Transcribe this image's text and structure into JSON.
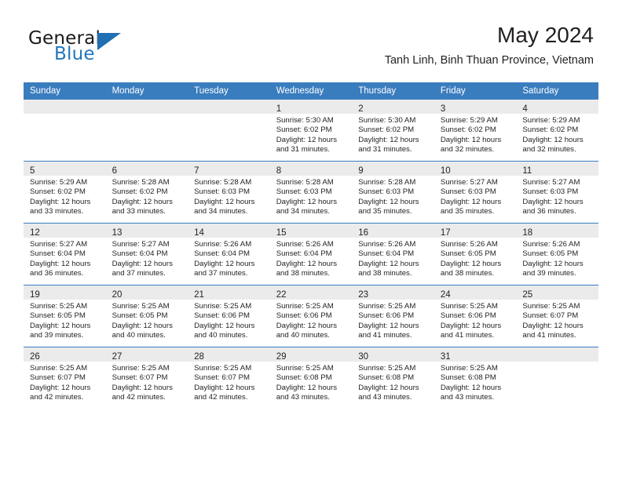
{
  "brand": {
    "name_top": "General",
    "name_bottom": "Blue",
    "accent_color": "#2175ba",
    "triangle_color": "#1f6fb2"
  },
  "header": {
    "title": "May 2024",
    "subtitle": "Tanh Linh, Binh Thuan Province, Vietnam"
  },
  "calendar": {
    "header_bg": "#3a7dbe",
    "daynum_bg": "#ebebeb",
    "weekdays": [
      "Sunday",
      "Monday",
      "Tuesday",
      "Wednesday",
      "Thursday",
      "Friday",
      "Saturday"
    ],
    "weeks": [
      [
        {
          "day": "",
          "lines": []
        },
        {
          "day": "",
          "lines": []
        },
        {
          "day": "",
          "lines": []
        },
        {
          "day": "1",
          "lines": [
            "Sunrise: 5:30 AM",
            "Sunset: 6:02 PM",
            "Daylight: 12 hours",
            "and 31 minutes."
          ]
        },
        {
          "day": "2",
          "lines": [
            "Sunrise: 5:30 AM",
            "Sunset: 6:02 PM",
            "Daylight: 12 hours",
            "and 31 minutes."
          ]
        },
        {
          "day": "3",
          "lines": [
            "Sunrise: 5:29 AM",
            "Sunset: 6:02 PM",
            "Daylight: 12 hours",
            "and 32 minutes."
          ]
        },
        {
          "day": "4",
          "lines": [
            "Sunrise: 5:29 AM",
            "Sunset: 6:02 PM",
            "Daylight: 12 hours",
            "and 32 minutes."
          ]
        }
      ],
      [
        {
          "day": "5",
          "lines": [
            "Sunrise: 5:29 AM",
            "Sunset: 6:02 PM",
            "Daylight: 12 hours",
            "and 33 minutes."
          ]
        },
        {
          "day": "6",
          "lines": [
            "Sunrise: 5:28 AM",
            "Sunset: 6:02 PM",
            "Daylight: 12 hours",
            "and 33 minutes."
          ]
        },
        {
          "day": "7",
          "lines": [
            "Sunrise: 5:28 AM",
            "Sunset: 6:03 PM",
            "Daylight: 12 hours",
            "and 34 minutes."
          ]
        },
        {
          "day": "8",
          "lines": [
            "Sunrise: 5:28 AM",
            "Sunset: 6:03 PM",
            "Daylight: 12 hours",
            "and 34 minutes."
          ]
        },
        {
          "day": "9",
          "lines": [
            "Sunrise: 5:28 AM",
            "Sunset: 6:03 PM",
            "Daylight: 12 hours",
            "and 35 minutes."
          ]
        },
        {
          "day": "10",
          "lines": [
            "Sunrise: 5:27 AM",
            "Sunset: 6:03 PM",
            "Daylight: 12 hours",
            "and 35 minutes."
          ]
        },
        {
          "day": "11",
          "lines": [
            "Sunrise: 5:27 AM",
            "Sunset: 6:03 PM",
            "Daylight: 12 hours",
            "and 36 minutes."
          ]
        }
      ],
      [
        {
          "day": "12",
          "lines": [
            "Sunrise: 5:27 AM",
            "Sunset: 6:04 PM",
            "Daylight: 12 hours",
            "and 36 minutes."
          ]
        },
        {
          "day": "13",
          "lines": [
            "Sunrise: 5:27 AM",
            "Sunset: 6:04 PM",
            "Daylight: 12 hours",
            "and 37 minutes."
          ]
        },
        {
          "day": "14",
          "lines": [
            "Sunrise: 5:26 AM",
            "Sunset: 6:04 PM",
            "Daylight: 12 hours",
            "and 37 minutes."
          ]
        },
        {
          "day": "15",
          "lines": [
            "Sunrise: 5:26 AM",
            "Sunset: 6:04 PM",
            "Daylight: 12 hours",
            "and 38 minutes."
          ]
        },
        {
          "day": "16",
          "lines": [
            "Sunrise: 5:26 AM",
            "Sunset: 6:04 PM",
            "Daylight: 12 hours",
            "and 38 minutes."
          ]
        },
        {
          "day": "17",
          "lines": [
            "Sunrise: 5:26 AM",
            "Sunset: 6:05 PM",
            "Daylight: 12 hours",
            "and 38 minutes."
          ]
        },
        {
          "day": "18",
          "lines": [
            "Sunrise: 5:26 AM",
            "Sunset: 6:05 PM",
            "Daylight: 12 hours",
            "and 39 minutes."
          ]
        }
      ],
      [
        {
          "day": "19",
          "lines": [
            "Sunrise: 5:25 AM",
            "Sunset: 6:05 PM",
            "Daylight: 12 hours",
            "and 39 minutes."
          ]
        },
        {
          "day": "20",
          "lines": [
            "Sunrise: 5:25 AM",
            "Sunset: 6:05 PM",
            "Daylight: 12 hours",
            "and 40 minutes."
          ]
        },
        {
          "day": "21",
          "lines": [
            "Sunrise: 5:25 AM",
            "Sunset: 6:06 PM",
            "Daylight: 12 hours",
            "and 40 minutes."
          ]
        },
        {
          "day": "22",
          "lines": [
            "Sunrise: 5:25 AM",
            "Sunset: 6:06 PM",
            "Daylight: 12 hours",
            "and 40 minutes."
          ]
        },
        {
          "day": "23",
          "lines": [
            "Sunrise: 5:25 AM",
            "Sunset: 6:06 PM",
            "Daylight: 12 hours",
            "and 41 minutes."
          ]
        },
        {
          "day": "24",
          "lines": [
            "Sunrise: 5:25 AM",
            "Sunset: 6:06 PM",
            "Daylight: 12 hours",
            "and 41 minutes."
          ]
        },
        {
          "day": "25",
          "lines": [
            "Sunrise: 5:25 AM",
            "Sunset: 6:07 PM",
            "Daylight: 12 hours",
            "and 41 minutes."
          ]
        }
      ],
      [
        {
          "day": "26",
          "lines": [
            "Sunrise: 5:25 AM",
            "Sunset: 6:07 PM",
            "Daylight: 12 hours",
            "and 42 minutes."
          ]
        },
        {
          "day": "27",
          "lines": [
            "Sunrise: 5:25 AM",
            "Sunset: 6:07 PM",
            "Daylight: 12 hours",
            "and 42 minutes."
          ]
        },
        {
          "day": "28",
          "lines": [
            "Sunrise: 5:25 AM",
            "Sunset: 6:07 PM",
            "Daylight: 12 hours",
            "and 42 minutes."
          ]
        },
        {
          "day": "29",
          "lines": [
            "Sunrise: 5:25 AM",
            "Sunset: 6:08 PM",
            "Daylight: 12 hours",
            "and 43 minutes."
          ]
        },
        {
          "day": "30",
          "lines": [
            "Sunrise: 5:25 AM",
            "Sunset: 6:08 PM",
            "Daylight: 12 hours",
            "and 43 minutes."
          ]
        },
        {
          "day": "31",
          "lines": [
            "Sunrise: 5:25 AM",
            "Sunset: 6:08 PM",
            "Daylight: 12 hours",
            "and 43 minutes."
          ]
        },
        {
          "day": "",
          "lines": []
        }
      ]
    ]
  }
}
